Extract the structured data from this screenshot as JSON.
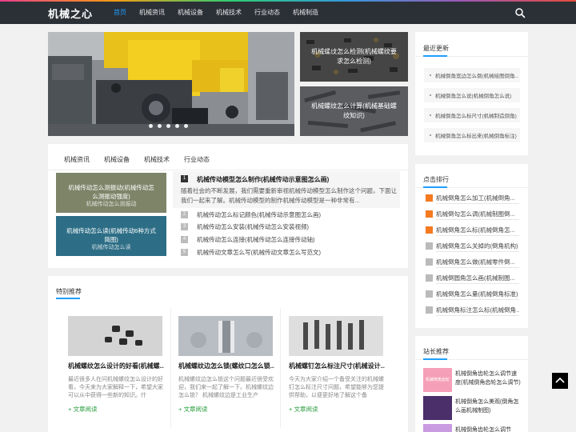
{
  "site": {
    "logo": "机械之心"
  },
  "nav": [
    "首页",
    "机械资讯",
    "机械设备",
    "机械技术",
    "行业动态",
    "机械制造"
  ],
  "slider": {
    "side_captions": [
      "机械螺纹怎么检测(机械螺纹要求怎么检测)",
      "机械螺纹怎么计算(机械基础螺纹知识)"
    ]
  },
  "tabs": [
    "机械资讯",
    "机械设备",
    "机械技术",
    "行业动态"
  ],
  "tab_thumbs": [
    {
      "title": "机械传动怎么测振动(机械传动怎么测振动强度)",
      "sub": "机械传动怎么测振动"
    },
    {
      "title": "机械传动怎么读(机械传动6种方式简图)",
      "sub": "机械传动怎么读"
    }
  ],
  "featured": {
    "num": "1",
    "title": "机械传动模型怎么制作(机械传动示意图怎么画)",
    "desc": "随着社会的不断发展，我们需要重新审视机械传动模型怎么制作这个问题，下面让我们一起来了解。机械传动模型的制作机械传动模型是一种非常有..."
  },
  "tab_list": [
    {
      "num": "2",
      "title": "机械传动怎么标记颜色(机械传动示意图怎么画)"
    },
    {
      "num": "3",
      "title": "机械传动怎么安装(机械传动怎么安装视频)"
    },
    {
      "num": "4",
      "title": "机械传动怎么连接(机械传动怎么连接传动轴)"
    },
    {
      "num": "5",
      "title": "机械传动文章怎么写(机械传动文章怎么写范文)"
    }
  ],
  "special": {
    "title": "特别推荐",
    "items": [
      {
        "title": "机械螺纹怎么设计的好看(机械螺...",
        "desc": "最近很多人在问机械螺纹怎么设计的好看，今天来为大家解释一下，希望大家可以从中获得一些新的知识。什",
        "more": "+ 文章阅读"
      },
      {
        "title": "机械螺纹边怎么锁(螺纹口怎么锁...",
        "desc": "机械螺纹边怎么锁这个问题最近很受欢迎，我们来一起了解一下。机械螺纹边怎么锁？ 机械螺纹边是工业生产",
        "more": "+ 文章阅读"
      },
      {
        "title": "机械螺钉怎么标注尺寸(机械设计...",
        "desc": "今天为大家介绍一个备受关注的机械螺钉怎么标注尺寸问题，希望能够为您提供帮助，以便更好地了解这个备",
        "more": "+ 文章阅读"
      }
    ]
  },
  "sidebar": {
    "latest": {
      "title": "最近更新",
      "items": [
        "机械倒角宽边怎么倒(机械绘图倒角...",
        "机械倒角怎么说(机械倒角怎么说)",
        "机械倒角怎么标尺寸(机械制造倒角)",
        "机械倒角怎么标出来(机械倒角标注)"
      ]
    },
    "ranking": {
      "title": "点击排行",
      "items": [
        "机械倒角怎么加工(机械倒角...",
        "机械倒勾怎么调(机械制图倒...",
        "机械倒角怎么标(机械倒角怎...",
        "机械倒角怎么关掉的(倒角机构)",
        "机械倒角怎么做(机械零件倒...",
        "机械倒圆角怎么画(机械制图...",
        "机械倒角怎么量(机械倒角标准)",
        "机械倒角标注怎么标(机械倒角..."
      ]
    },
    "picks": {
      "title": "站长推荐",
      "items": [
        {
          "title": "机械倒角齿轮怎么调节速度(机械倒角齿轮怎么调节)",
          "thumb": "机械倒角齿轮"
        },
        {
          "title": "机械倒角怎么美观(倒角怎么画机械制图)",
          "thumb": ""
        },
        {
          "title": "机械倒角齿轮怎么调节",
          "thumb": ""
        }
      ]
    }
  },
  "colors": {
    "accent": "#1e9fff",
    "header": "#2b2f36",
    "rank_hot": "#f47a20",
    "read_more": "#2a9d3f"
  }
}
